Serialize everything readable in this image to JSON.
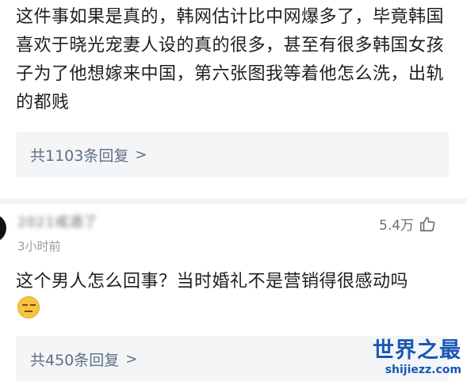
{
  "comment1": {
    "text": "这件事如果是真的，韩网估计比中网爆多了，毕竟韩国喜欢于晓光宠妻人设的真的很多，甚至有很多韩国女孩子为了他想嫁来中国，第六张图我等着他怎么洗，出轨的都贱",
    "replies_label": "共1103条回复",
    "chevron": ">"
  },
  "comment2": {
    "username": "2021戒酒了",
    "timestamp": "3小时前",
    "likes": "5.4万",
    "like_icon": "thumbs-up-icon",
    "text": "这个男人怎么回事？当时婚礼不是营销得很感动吗",
    "emoji_icon": "awkward-face-emoji",
    "replies_label": "共450条回复",
    "chevron": ">"
  },
  "watermark": {
    "title": "世界之最",
    "url": "shijiezz.com"
  },
  "colors": {
    "reply_text": "#5f6f86",
    "reply_bg": "#f3f5f7",
    "watermark": "#1a57b5"
  }
}
